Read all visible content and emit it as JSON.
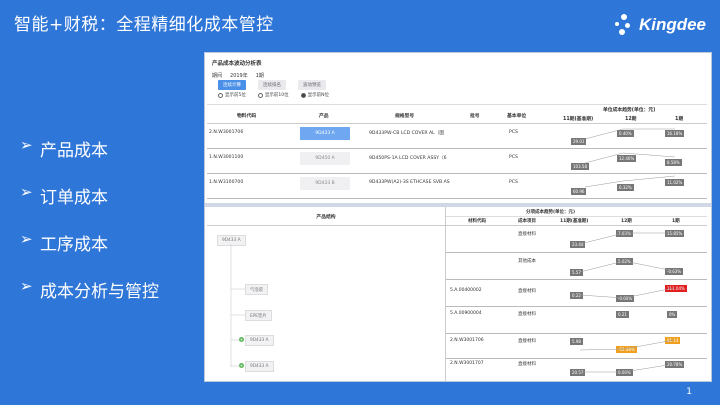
{
  "slide": {
    "title": "智能+财税：全程精细化成本管控",
    "logo_text": "Kingdee",
    "page_number": "1",
    "bullets": [
      "产品成本",
      "订单成本",
      "工序成本",
      "成本分析与管控"
    ]
  },
  "report": {
    "title": "产品成本波动分析表",
    "period_label": "期间",
    "period_year": "2019年",
    "period_value": "1期",
    "buttons": [
      "连续计算",
      "连续排名",
      "波动预览"
    ],
    "radios": [
      "显示前5位",
      "显示前10位",
      "显示前N位"
    ],
    "colors": {
      "accent": "#4a8fe8",
      "warn": "#f0a020",
      "danger": "#e02020"
    }
  },
  "top_table": {
    "headers": [
      "物料代码",
      "产品",
      "规格型号",
      "批号",
      "基本单位"
    ],
    "trend_header": "单位成本趋势(单位：元)",
    "trend_cols": [
      "11期(基准期)",
      "12期",
      "1期"
    ],
    "rows": [
      {
        "code": "2.N.W3001706",
        "product": "9D433 A",
        "spec": "9D433PW-CB LCD COVER AL（国",
        "batch": "",
        "unit": "PCS",
        "v11": "29.01",
        "v12": "0.40%",
        "v1": "16.18%"
      },
      {
        "code": "1.N.W3001100",
        "product": "9D450 A",
        "spec": "9D450PS-1A LCD COVER ASSY（6",
        "batch": "",
        "unit": "PCS",
        "v11": "103.58",
        "v12": "12.40%",
        "v1": "8.58%"
      },
      {
        "code": "1.N.W3100700",
        "product": "9D433 B",
        "spec": "9D433PW(A2)-3S ETHCASE SVB AS",
        "batch": "",
        "unit": "PCS",
        "v11": "60.96",
        "v12": "0.32%",
        "v1": "11.02%"
      }
    ]
  },
  "bottom": {
    "structure_header": "产品结构",
    "tree": {
      "root": "9D433 A",
      "children": [
        "气泡袋",
        "EPE垫片",
        "9D433 A",
        "9D433 A"
      ]
    },
    "cost_header": "分项成本趋势(单位：元)",
    "cols": [
      "材料代码",
      "成本项目",
      "11期(基准期)",
      "12期",
      "1期"
    ],
    "rows": [
      {
        "code": "",
        "item": "直接材料",
        "v11": "23.44",
        "v12": "7.03%",
        "v1": "15.85%"
      },
      {
        "code": "",
        "item": "其他成本",
        "v11": "5.57",
        "v12": "5.02%",
        "v1": "-0.63%"
      },
      {
        "code": "5.A.00400002",
        "item": "直接材料",
        "v11": "0.22",
        "v12": "-0.00%",
        "v1": "111.04%"
      },
      {
        "code": "5.A.00900004",
        "item": "直接材料",
        "v11": "",
        "v12": "0.21",
        "v1": "0%"
      },
      {
        "code": "2.N.W3001706",
        "item": "直接材料",
        "v11": "5.98",
        "v12": "-52.48%",
        "v1": "81.14"
      },
      {
        "code": "2.N.W3001707",
        "item": "直接材料",
        "v11": "20.57",
        "v12": "0.00%",
        "v1": "20.78%"
      }
    ]
  }
}
